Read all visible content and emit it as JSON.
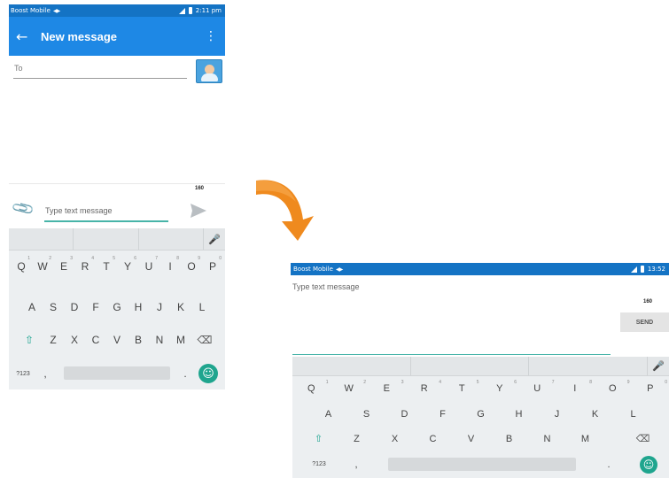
{
  "phone_portrait": {
    "status": {
      "carrier": "Boost Mobile",
      "time": "2:11 pm"
    },
    "appbar": {
      "title": "New message"
    },
    "to_label": "To",
    "char_count": "160",
    "message_placeholder": "Type text message"
  },
  "phone_landscape": {
    "status": {
      "carrier": "Boost Mobile",
      "time": "13:52"
    },
    "message_placeholder": "Type text message",
    "char_count": "160",
    "send_label": "SEND"
  },
  "keyboard_rows": [
    [
      "Q",
      "W",
      "E",
      "R",
      "T",
      "Y",
      "U",
      "I",
      "O",
      "P"
    ],
    [
      "A",
      "S",
      "D",
      "F",
      "G",
      "H",
      "J",
      "K",
      "L"
    ],
    [
      "Z",
      "X",
      "C",
      "V",
      "B",
      "N",
      "M"
    ]
  ],
  "keyboard_number_hints": [
    "1",
    "2",
    "3",
    "4",
    "5",
    "6",
    "7",
    "8",
    "9",
    "0"
  ],
  "keyboard_bottom": {
    "symbols_label": "?123",
    "comma": ",",
    "period": "."
  },
  "icons": {
    "back": "arrow-left-icon",
    "overflow": "more-vertical-icon",
    "contact": "contact-picker-icon",
    "attach": "paperclip-icon",
    "send": "send-icon",
    "mic": "microphone-icon",
    "shift": "shift-icon",
    "backspace": "backspace-icon",
    "emoji": "smiley-icon",
    "transition": "curved-arrow-icon"
  },
  "colors": {
    "status_bar": "#1473c4",
    "app_bar": "#1e88e5",
    "accent": "#1fa58e",
    "arrow": "#ef8a1e"
  }
}
